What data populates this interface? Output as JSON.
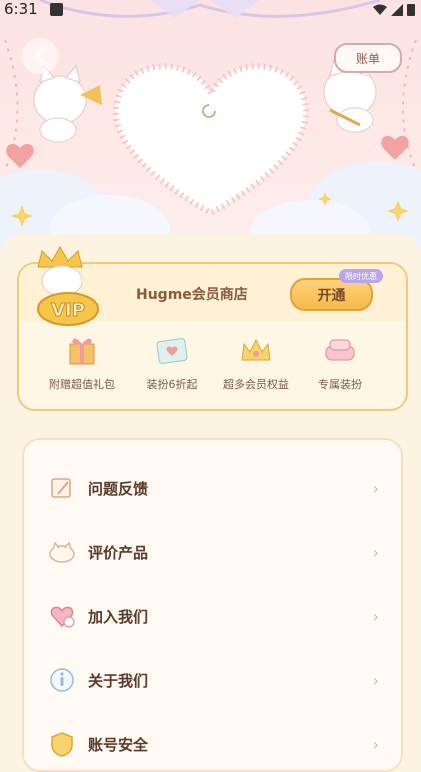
{
  "status_bar": {
    "time": "6:31"
  },
  "header": {
    "back_icon": "chevron-left-icon",
    "bill_label": "账单"
  },
  "vip": {
    "title": "Hugme会员商店",
    "open_label": "开通",
    "tag_label": "限时优惠",
    "badge_text": "VIP",
    "benefits": [
      {
        "label": "附赠超值礼包",
        "icon": "gift-box-icon"
      },
      {
        "label": "装扮6折起",
        "icon": "decor-card-icon"
      },
      {
        "label": "超多会员权益",
        "icon": "crown-icon"
      },
      {
        "label": "专属装扮",
        "icon": "sofa-icon"
      }
    ]
  },
  "menu": {
    "items": [
      {
        "label": "问题反馈",
        "icon": "feedback-icon"
      },
      {
        "label": "评价产品",
        "icon": "rate-icon"
      },
      {
        "label": "加入我们",
        "icon": "join-icon"
      },
      {
        "label": "关于我们",
        "icon": "info-icon"
      },
      {
        "label": "账号安全",
        "icon": "shield-icon"
      }
    ],
    "arrow": "›"
  },
  "colors": {
    "accent": "#f6b94a",
    "card_border": "#f0c97a",
    "background": "#fdf3e3"
  }
}
